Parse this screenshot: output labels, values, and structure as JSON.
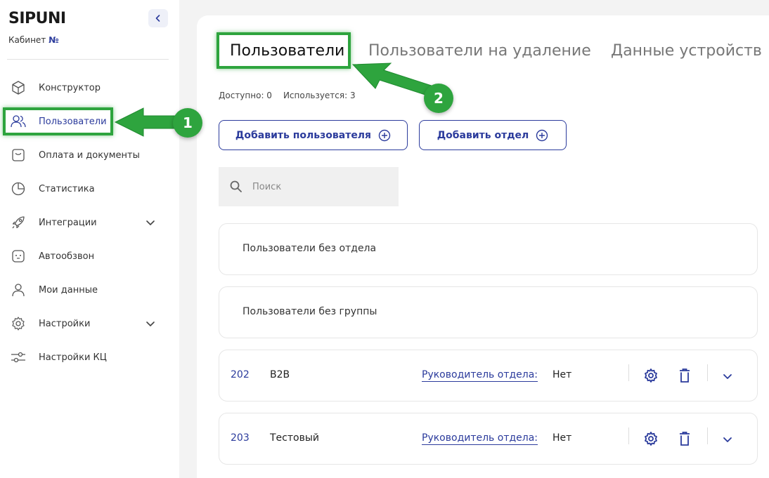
{
  "sidebar": {
    "logo": "SIPUNI",
    "cabinet_label": "Кабинет",
    "cabinet_no": "№",
    "items": [
      {
        "label": "Конструктор"
      },
      {
        "label": "Пользователи"
      },
      {
        "label": "Оплата и документы"
      },
      {
        "label": "Статистика"
      },
      {
        "label": "Интеграции"
      },
      {
        "label": "Автообзвон"
      },
      {
        "label": "Мои данные"
      },
      {
        "label": "Настройки"
      },
      {
        "label": "Настройки КЦ"
      }
    ]
  },
  "tabs": [
    {
      "label": "Пользователи"
    },
    {
      "label": "Пользователи на удаление"
    },
    {
      "label": "Данные устройств"
    }
  ],
  "stats": {
    "available": "Доступно: 0",
    "used": "Используется: 3"
  },
  "buttons": {
    "add_user": "Добавить пользователя",
    "add_dept": "Добавить отдел"
  },
  "search": {
    "placeholder": "Поиск"
  },
  "groups": [
    {
      "title": "Пользователи без отдела"
    },
    {
      "title": "Пользователи без группы"
    }
  ],
  "departments": [
    {
      "num": "202",
      "name": "B2B",
      "manager_label": "Руководитель отдела:",
      "manager_value": "Нет"
    },
    {
      "num": "203",
      "name": "Тестовый",
      "manager_label": "Руководитель отдела:",
      "manager_value": "Нет"
    }
  ],
  "annotations": {
    "badge1": "1",
    "badge2": "2",
    "color": "#2ea43e"
  },
  "colors": {
    "accent": "#2b3b9c",
    "annotation": "#2ea43e"
  }
}
